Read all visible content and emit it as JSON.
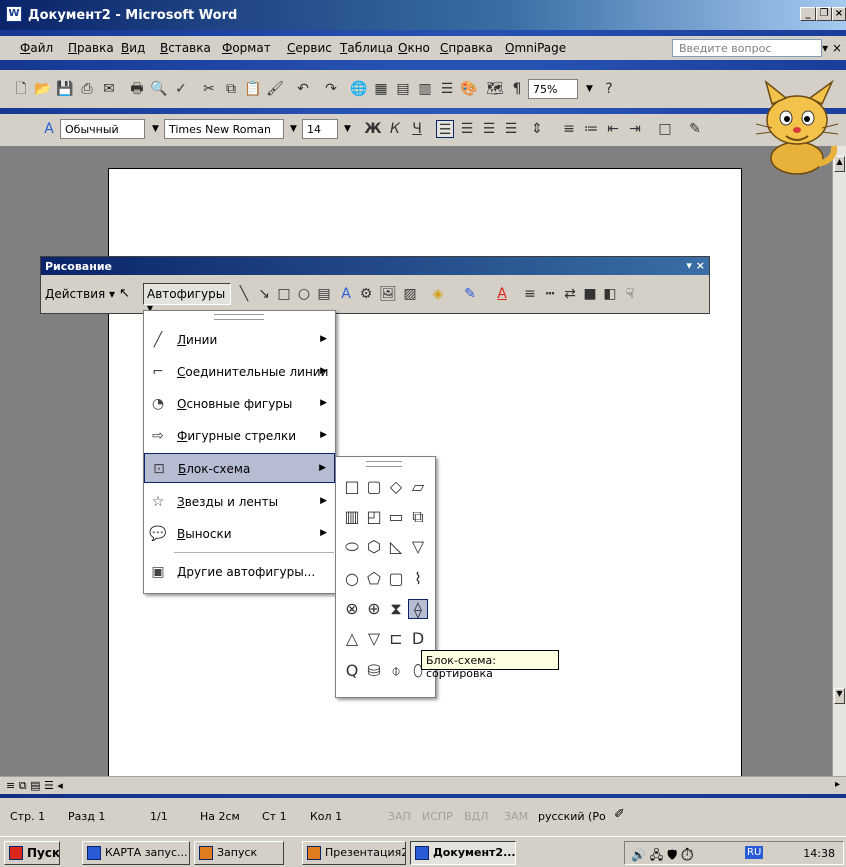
{
  "window": {
    "title": "Документ2 - Microsoft Word"
  },
  "menubar": {
    "items": [
      "Файл",
      "Правка",
      "Вид",
      "Вставка",
      "Формат",
      "Сервис",
      "Таблица",
      "Окно",
      "Справка",
      "OmniPage"
    ],
    "question_placeholder": "Введите вопрос"
  },
  "toolbar_standard": {
    "zoom": "75%"
  },
  "toolbar_format": {
    "style": "Обычный",
    "font": "Times New Roman",
    "size": "14",
    "bold": "Ж",
    "italic": "К",
    "underline": "Ч"
  },
  "drawing_toolbar": {
    "title": "Рисование",
    "actions": "Действия",
    "autoshapes": "Автофигуры"
  },
  "autoshapes_menu": {
    "items": [
      {
        "label": "Линии",
        "has_submenu": true
      },
      {
        "label": "Соединительные линии",
        "has_submenu": true
      },
      {
        "label": "Основные фигуры",
        "has_submenu": true
      },
      {
        "label": "Фигурные стрелки",
        "has_submenu": true
      },
      {
        "label": "Блок-схема",
        "has_submenu": true,
        "selected": true
      },
      {
        "label": "Звезды и ленты",
        "has_submenu": true
      },
      {
        "label": "Выноски",
        "has_submenu": true
      },
      {
        "label": "Другие автофигуры...",
        "has_submenu": false
      }
    ]
  },
  "flowchart_submenu": {
    "tooltip": "Блок-схема: сортировка",
    "hovered_shape": "sort-shape"
  },
  "statusbar": {
    "page": "Стр. 1",
    "section": "Разд 1",
    "pages": "1/1",
    "at": "На 2см",
    "line": "Ст 1",
    "column": "Кол 1",
    "rec": "ЗАП",
    "trk": "ИСПР",
    "ext": "ВДЛ",
    "ovr": "ЗАМ",
    "language": "русский (Ро"
  },
  "taskbar": {
    "start": "Пуск",
    "tasks": [
      {
        "label": "КАРТА запус..."
      },
      {
        "label": "Запуск"
      },
      {
        "label": "Презентация2"
      },
      {
        "label": "Документ2...",
        "active": true
      }
    ],
    "language": "RU",
    "clock": "14:38"
  }
}
